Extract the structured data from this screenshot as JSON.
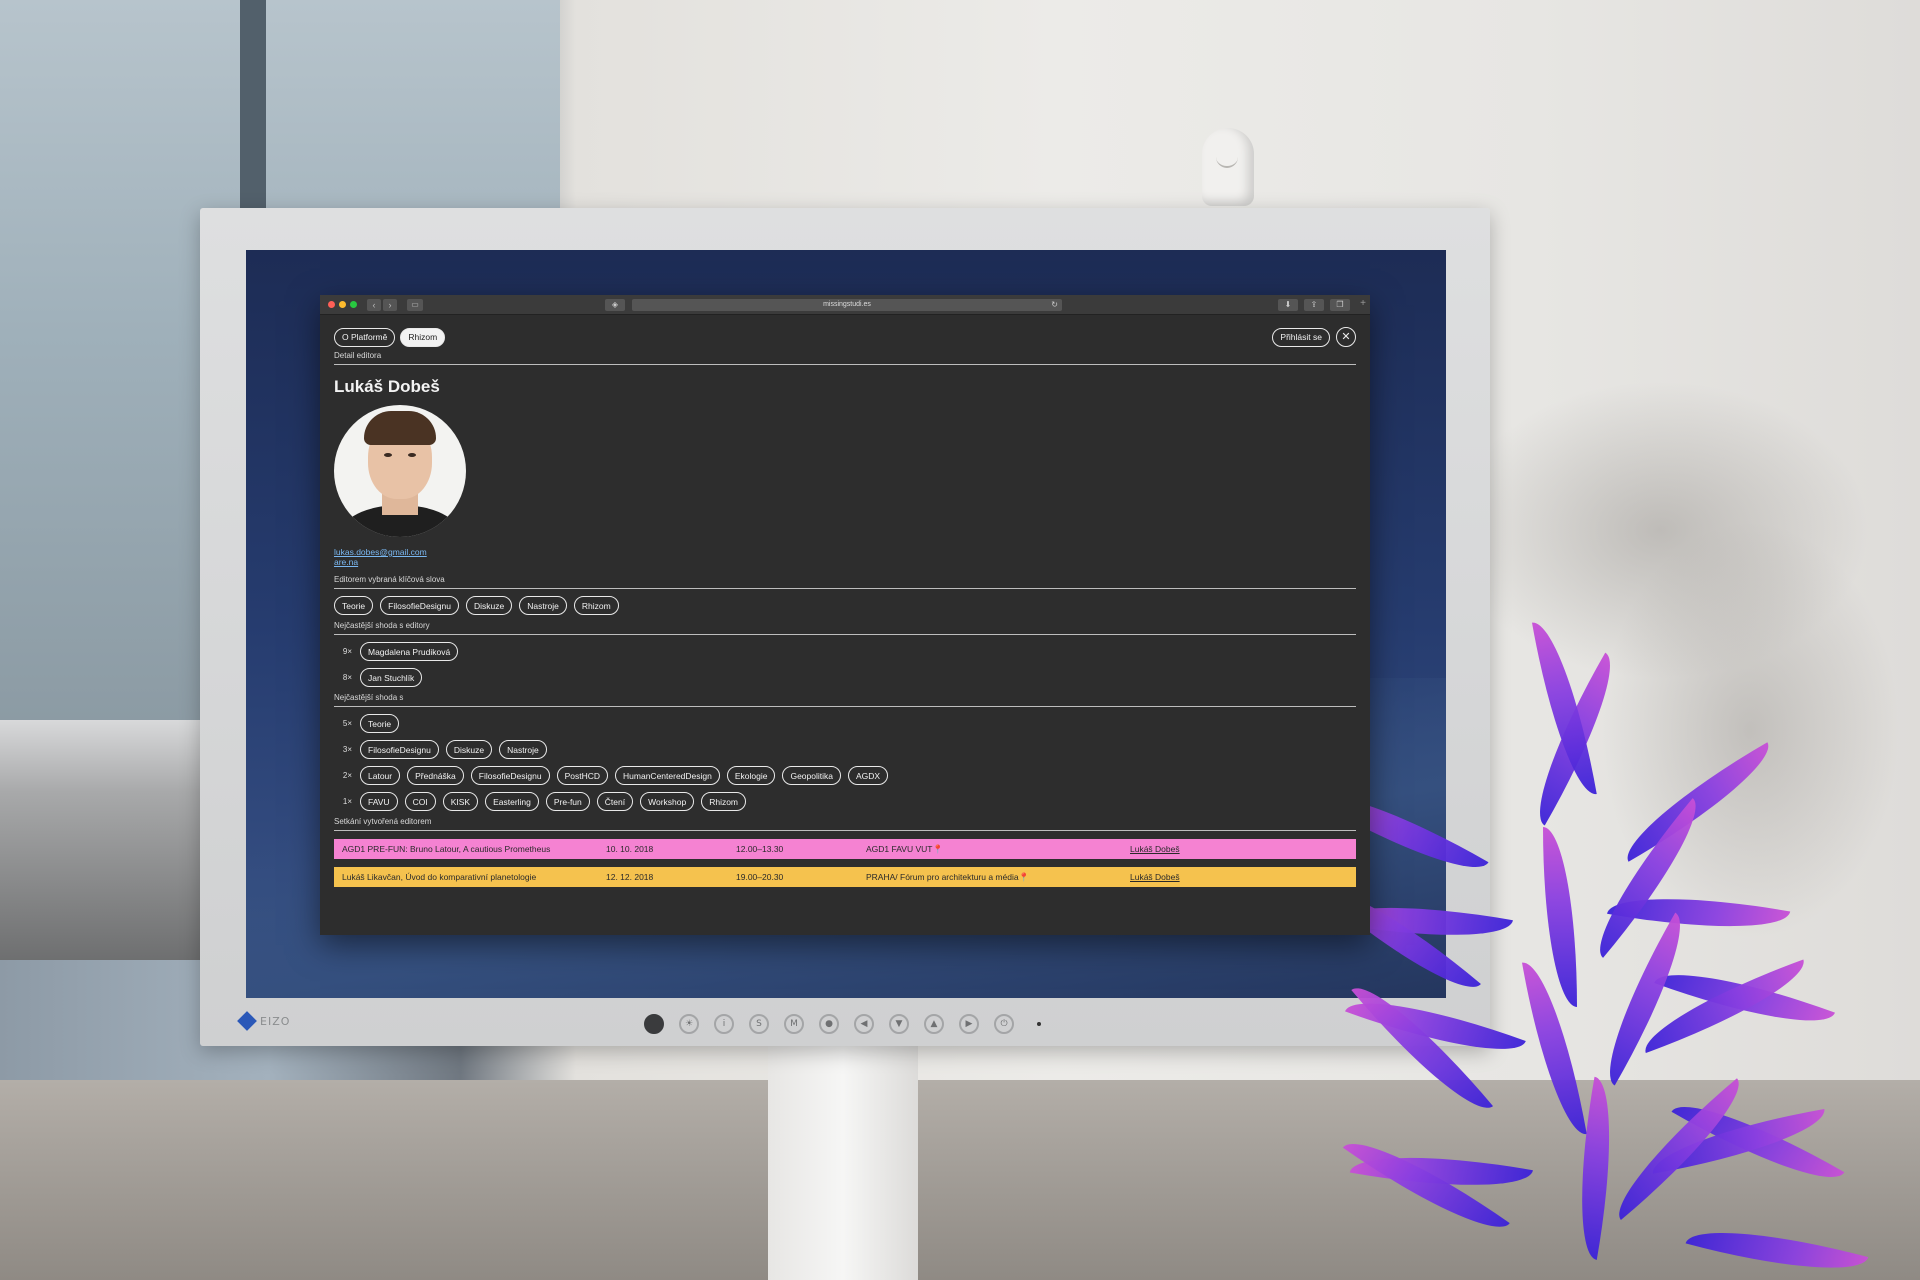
{
  "monitor": {
    "brand": "EIZO",
    "buttons": [
      "☀",
      "i",
      "S",
      "M",
      "●",
      "◀",
      "▼",
      "▲",
      "▶",
      "⏻"
    ]
  },
  "browser": {
    "url": "missingstudi.es",
    "nav_back": "‹",
    "nav_forward": "›"
  },
  "page": {
    "nav": {
      "platform": "O Platformě",
      "rhizom": "Rhizom",
      "login": "Přihlásit se",
      "close": "✕"
    },
    "breadcrumb": "Detail editora",
    "editor_name": "Lukáš Dobeš",
    "email": "lukas.dobes@gmail.com",
    "arena": "are.na",
    "keywords_label": "Editorem vybraná klíčová slova",
    "keywords": [
      "Teorie",
      "FilosofieDesignu",
      "Diskuze",
      "Nastroje",
      "Rhizom"
    ],
    "editor_match_label": "Nejčastější shoda s editory",
    "editor_matches": [
      {
        "count": "9×",
        "name": "Magdalena Prudiková"
      },
      {
        "count": "8×",
        "name": "Jan Stuchlík"
      }
    ],
    "tag_match_label": "Nejčastější shoda s",
    "tag_matches": [
      {
        "count": "5×",
        "tags": [
          "Teorie"
        ]
      },
      {
        "count": "3×",
        "tags": [
          "FilosofieDesignu",
          "Diskuze",
          "Nastroje"
        ]
      },
      {
        "count": "2×",
        "tags": [
          "Latour",
          "Přednáška",
          "FilosofieDesignu",
          "PostHCD",
          "HumanCenteredDesign",
          "Ekologie",
          "Geopolitika",
          "AGDX"
        ]
      },
      {
        "count": "1×",
        "tags": [
          "FAVU",
          "COI",
          "KISK",
          "Easterling",
          "Pre-fun",
          "Čtení",
          "Workshop",
          "Rhizom"
        ]
      }
    ],
    "events_label": "Setkání vytvořená editorem",
    "events": [
      {
        "title": "AGD1 PRE-FUN: Bruno Latour, A cautious Prometheus",
        "date": "10. 10. 2018",
        "time": "12.00–13.30",
        "place": "AGD1 FAVU VUT",
        "editor": "Lukáš Dobeš",
        "color": "#f582d2"
      },
      {
        "title": "Lukáš Likavčan, Úvod do komparativní planetologie",
        "date": "12. 12. 2018",
        "time": "19.00–20.30",
        "place": "PRAHA/ Fórum pro architekturu a média",
        "editor": "Lukáš Dobeš",
        "color": "#f5c24e"
      }
    ]
  }
}
